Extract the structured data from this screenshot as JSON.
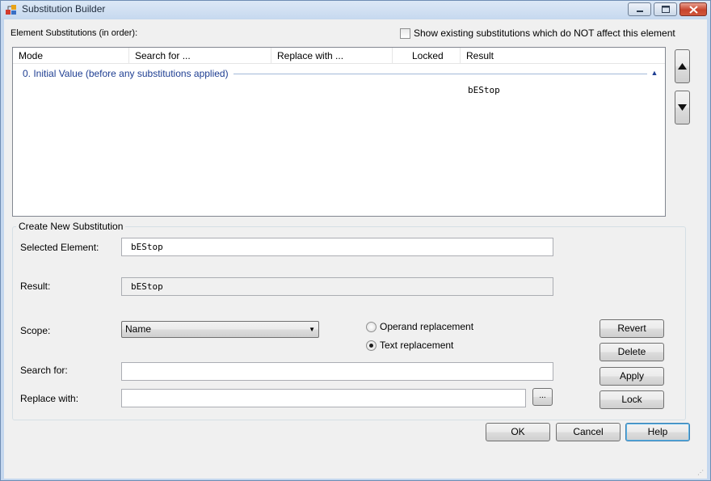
{
  "window": {
    "title": "Substitution Builder",
    "icon": "app-icon",
    "controls": [
      "minimize-icon",
      "maximize-icon",
      "close-icon"
    ]
  },
  "substitutions": {
    "label": "Element Substitutions (in order):",
    "show_nonaffecting_label": "Show existing substitutions which do NOT affect this element",
    "show_nonaffecting_checked": false,
    "columns": [
      "Mode",
      "Search for ...",
      "Replace with ...",
      "Locked",
      "Result"
    ],
    "group_label": "0. Initial Value (before any substitutions applied)",
    "rows": [
      {
        "mode": "",
        "search": "",
        "replace": "",
        "locked": "",
        "result": "bEStop"
      }
    ]
  },
  "create": {
    "title": "Create New Substitution",
    "selected_label": "Selected Element:",
    "selected_value": "bEStop",
    "result_label": "Result:",
    "result_value": "bEStop",
    "scope_label": "Scope:",
    "scope_value": "Name",
    "operand_label": "Operand replacement",
    "text_label": "Text replacement",
    "selected_mode": "Text replacement",
    "search_label": "Search for:",
    "search_value": "",
    "replace_label": "Replace with:",
    "replace_value": "",
    "browse_label": "...",
    "revert_label": "Revert",
    "delete_label": "Delete",
    "apply_label": "Apply",
    "lock_label": "Lock"
  },
  "footer": {
    "ok_label": "OK",
    "cancel_label": "Cancel",
    "help_label": "Help"
  }
}
